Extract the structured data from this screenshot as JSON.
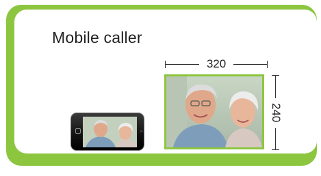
{
  "title": "Mobile caller",
  "dimensions": {
    "width": "320",
    "height": "240"
  },
  "colors": {
    "accent": "#8cc63f",
    "text": "#222222"
  },
  "icons": {
    "phone": "smartphone-icon",
    "home": "home-button-icon",
    "camera": "camera-icon"
  }
}
